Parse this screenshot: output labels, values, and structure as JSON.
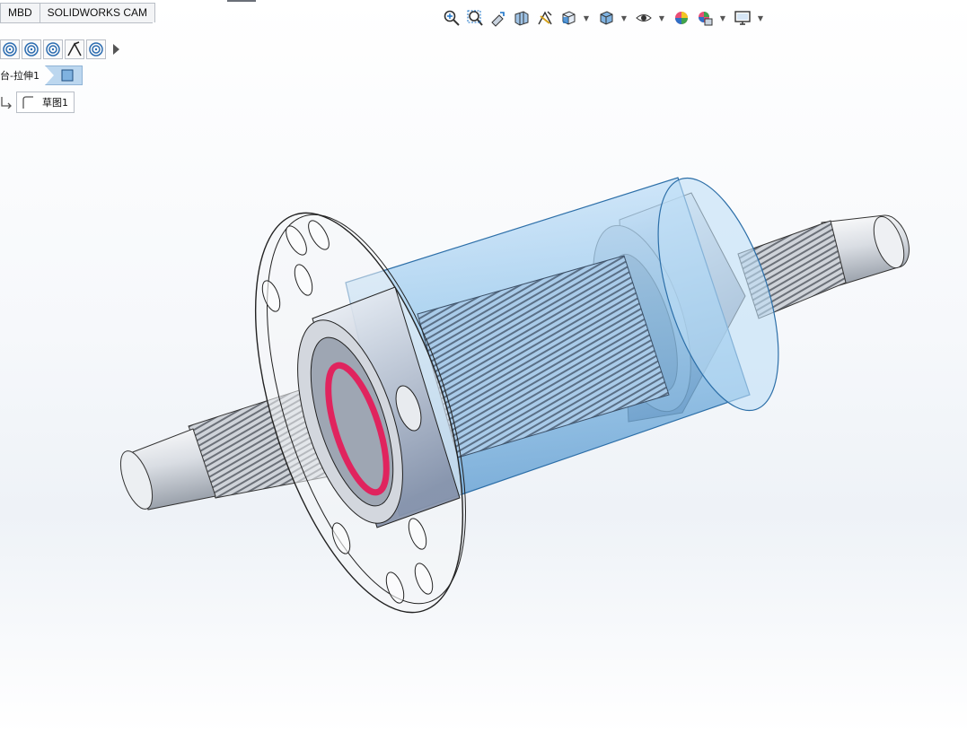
{
  "tabs": [
    {
      "label": "MBD"
    },
    {
      "label": "SOLIDWORKS CAM"
    }
  ],
  "view_toolbar": {
    "icons": [
      "zoom-to-fit-icon",
      "zoom-to-area-icon",
      "previous-view-icon",
      "section-view-icon",
      "dynamic-annotation-icon",
      "view-orientation-icon",
      "display-style-icon",
      "hide-show-items-icon",
      "edit-appearance-icon",
      "apply-scene-icon",
      "view-settings-icon"
    ]
  },
  "context_toolbar": {
    "icons": [
      "concentric-icon-1",
      "concentric-icon-2",
      "concentric-icon-3",
      "perpendicular-icon",
      "concentric-icon-4",
      "expand-arrow-icon"
    ]
  },
  "breadcrumb": {
    "feature_label": "台-拉伸1",
    "sketch_label": "草图1"
  },
  "colors": {
    "transparent_blue": "#8ec3ea",
    "accent_red": "#e0245e",
    "metal": "#d9dde3"
  }
}
